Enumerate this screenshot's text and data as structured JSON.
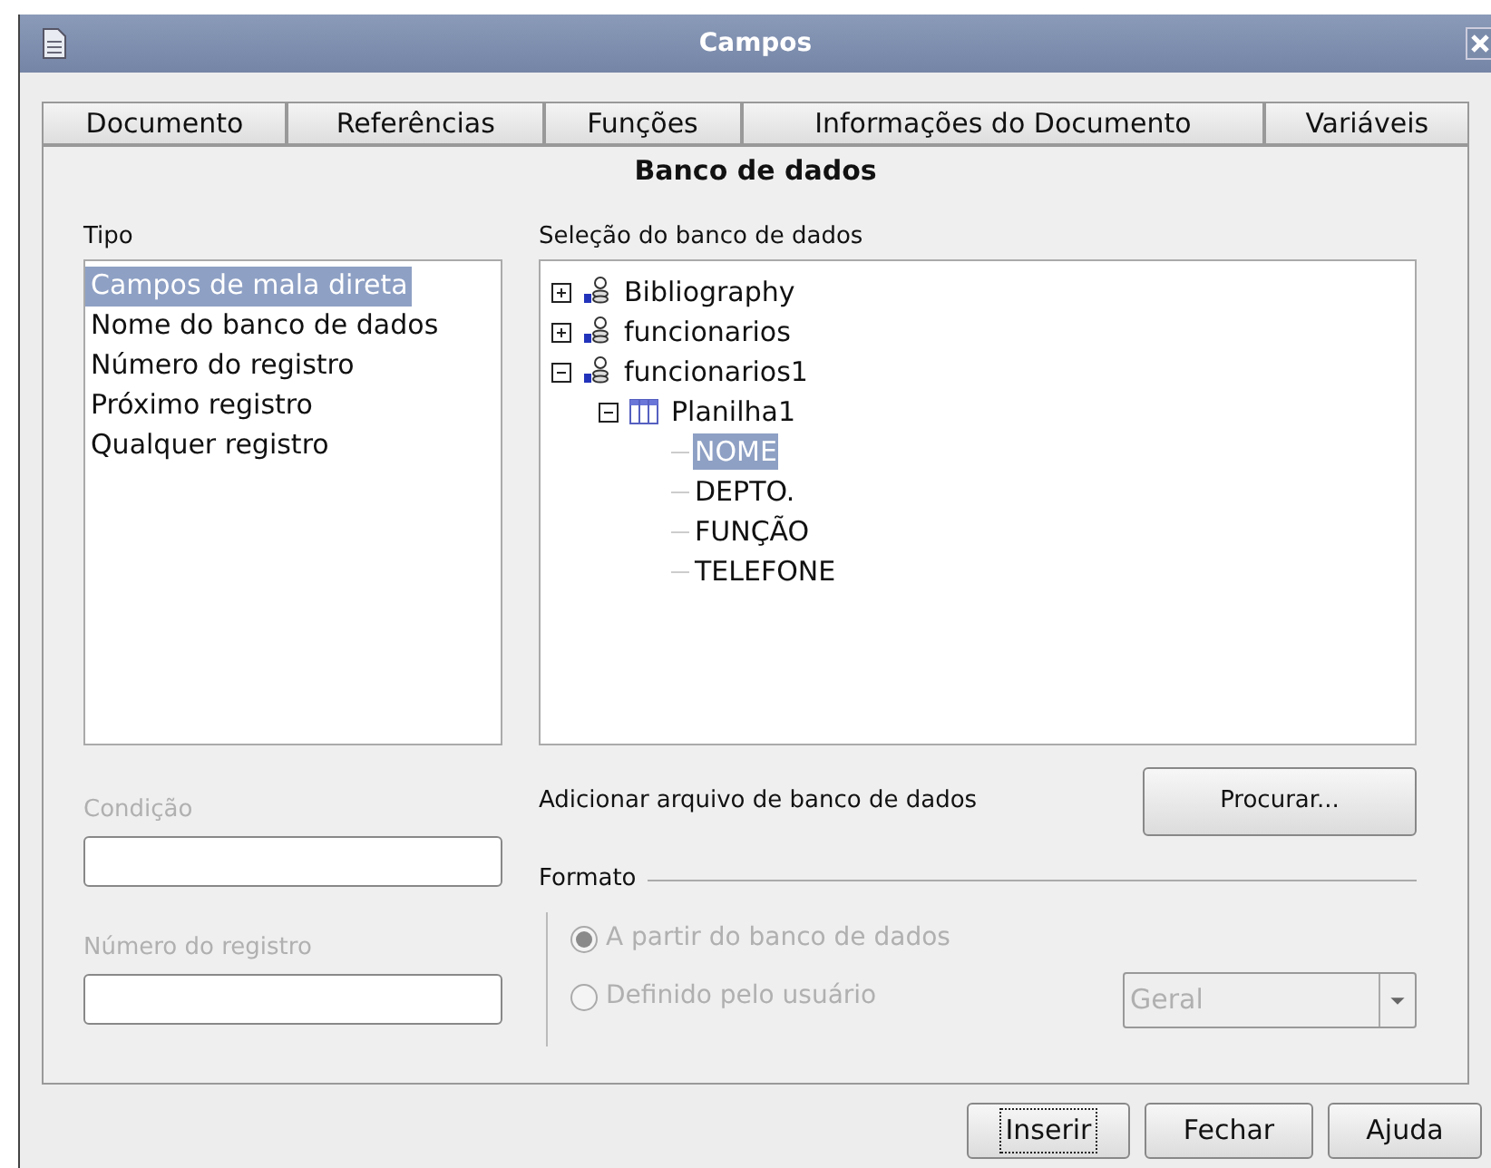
{
  "window": {
    "title": "Campos"
  },
  "tabs": [
    {
      "label": "Documento",
      "selected": false
    },
    {
      "label": "Referências",
      "selected": false
    },
    {
      "label": "Funções",
      "selected": false
    },
    {
      "label": "Informações do Documento",
      "selected": false
    },
    {
      "label": "Variáveis",
      "selected": false
    },
    {
      "label": "Banco de dados",
      "selected": true
    }
  ],
  "type_list": {
    "label": "Tipo",
    "items": [
      {
        "label": "Campos de mala direta",
        "selected": true
      },
      {
        "label": "Nome do banco de dados",
        "selected": false
      },
      {
        "label": "Número do registro",
        "selected": false
      },
      {
        "label": "Próximo registro",
        "selected": false
      },
      {
        "label": "Qualquer registro",
        "selected": false
      }
    ]
  },
  "condition": {
    "label": "Condição",
    "disabled": true
  },
  "record_number": {
    "label": "Número do registro",
    "disabled": true
  },
  "database_selection": {
    "label": "Seleção do banco de dados",
    "tree": [
      {
        "label": "Bibliography",
        "kind": "database",
        "expanded": false,
        "selected": false
      },
      {
        "label": "funcionarios",
        "kind": "database",
        "expanded": false,
        "selected": false
      },
      {
        "label": "funcionarios1",
        "kind": "database",
        "expanded": true,
        "selected": false,
        "children": [
          {
            "label": "Planilha1",
            "kind": "table",
            "expanded": true,
            "selected": false,
            "children": [
              {
                "label": "NOME",
                "kind": "field",
                "selected": true
              },
              {
                "label": "DEPTO.",
                "kind": "field",
                "selected": false
              },
              {
                "label": "FUNÇÃO",
                "kind": "field",
                "selected": false
              },
              {
                "label": "TELEFONE",
                "kind": "field",
                "selected": false
              }
            ]
          }
        ]
      }
    ]
  },
  "add_database": {
    "label": "Adicionar arquivo de banco de dados",
    "button": "Procurar..."
  },
  "format": {
    "label": "Formato",
    "options": [
      {
        "label": "A partir do banco de dados",
        "selected": true,
        "disabled": true
      },
      {
        "label": "Definido pelo usuário",
        "selected": false,
        "disabled": true
      }
    ],
    "combo": {
      "value": "Geral",
      "disabled": true
    }
  },
  "buttons": [
    {
      "label": "Inserir",
      "focused": true
    },
    {
      "label": "Fechar",
      "focused": false
    },
    {
      "label": "Ajuda",
      "focused": false
    }
  ]
}
